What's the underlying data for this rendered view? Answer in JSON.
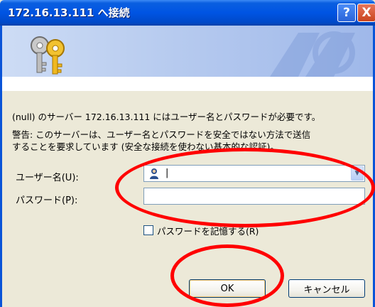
{
  "window": {
    "title": "172.16.13.111 へ接続",
    "help_label": "?",
    "close_label": "X"
  },
  "dialog": {
    "message": "(null) のサーバー 172.16.13.111 にはユーザー名とパスワードが必要です。",
    "warning": "警告: このサーバーは、ユーザー名とパスワードを安全ではない方法で送信\nすることを要求しています (安全な接続を使わない基本的な認証)。",
    "username_label": "ユーザー名(U):",
    "username_value": "|",
    "password_label": "パスワード(P):",
    "password_value": "",
    "remember_label": "パスワードを記憶する(R)",
    "remember_checked": false,
    "ok_label": "OK",
    "cancel_label": "キャンセル"
  },
  "annotations": {
    "highlight_color": "#ff0000"
  }
}
